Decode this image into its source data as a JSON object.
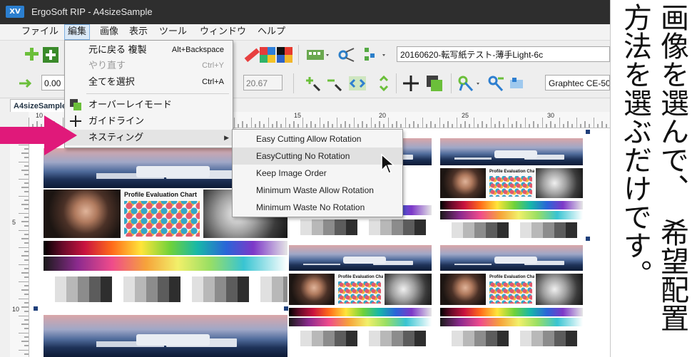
{
  "window": {
    "title": "ErgoSoft RIP - A4sizeSample",
    "logo_text": "XV"
  },
  "menubar": [
    {
      "label": "ファイル"
    },
    {
      "label": "編集"
    },
    {
      "label": "画像"
    },
    {
      "label": "表示"
    },
    {
      "label": "ツール"
    },
    {
      "label": "ウィンドウ"
    },
    {
      "label": "ヘルプ"
    }
  ],
  "toolbar": {
    "profile_combo": "20160620-転写紙テスト-薄手Light-6c",
    "zero_field": "0.00",
    "width_field": "20.67",
    "device_combo": "Graphtec CE-50"
  },
  "document": {
    "tab_label": "A4sizeSample"
  },
  "rulers": {
    "top_numbers": [
      "10",
      "15",
      "20",
      "25",
      "30"
    ],
    "left_numbers": [
      "5",
      "10"
    ]
  },
  "edit_menu": {
    "items": [
      {
        "label": "元に戻る 複製",
        "shortcut": "Alt+Backspace",
        "enabled": true
      },
      {
        "label": "やり直す",
        "shortcut": "Ctrl+Y",
        "enabled": false
      },
      {
        "label": "全てを選択",
        "shortcut": "Ctrl+A",
        "enabled": true
      },
      {
        "label": "オーバーレイモード",
        "shortcut": "",
        "enabled": true
      },
      {
        "label": "ガイドライン",
        "shortcut": "",
        "enabled": true
      },
      {
        "label": "ネスティング",
        "shortcut": "",
        "enabled": true
      }
    ]
  },
  "nesting_submenu": {
    "items": [
      {
        "label": "Easy Cutting Allow Rotation"
      },
      {
        "label": "EasyCutting No Rotation"
      },
      {
        "label": "Keep Image Order"
      },
      {
        "label": "Minimum Waste Allow Rotation"
      },
      {
        "label": "Minimum Waste No Rotation"
      }
    ],
    "highlighted_index": 1
  },
  "canvas": {
    "chart_label": "Profile Evaluation Chart"
  },
  "caption": {
    "col1": "画像を選んで、",
    "col2": "方法を選ぶだけです。",
    "col3": "希望配置"
  },
  "colors": {
    "accent_arrow": "#e0197a",
    "titlebar": "#2e2e2e",
    "menu_highlight": "#dbe9f7"
  }
}
